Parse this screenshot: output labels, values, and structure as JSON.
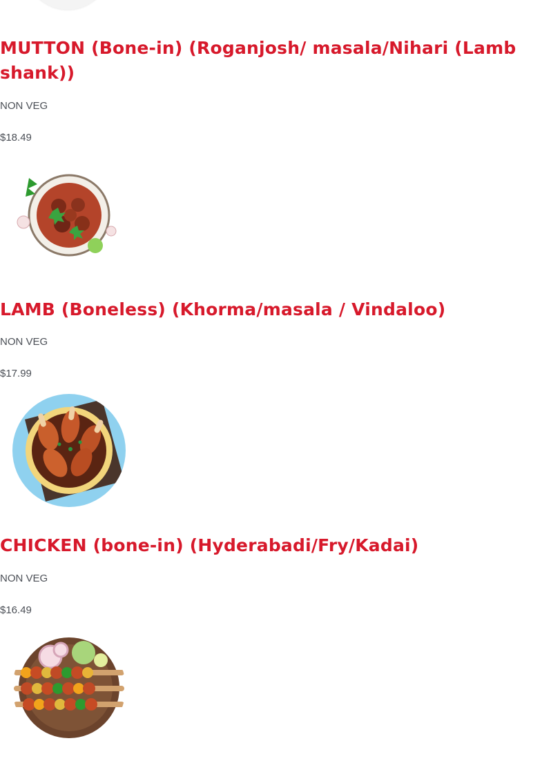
{
  "menu": {
    "items": [
      {
        "name": "MUTTON (Bone-in) (Roganjosh/ masala/Nihari (Lamb shank))",
        "tag": "NON VEG",
        "price": "$18.49",
        "image": "mutton-curry-bowl"
      },
      {
        "name": "LAMB (Boneless) (Khorma/masala / Vindaloo)",
        "tag": "NON VEG",
        "price": "$17.99",
        "image": "chicken-drumstick-curry"
      },
      {
        "name": "CHICKEN (bone-in) (Hyderabadi/Fry/Kadai)",
        "tag": "NON VEG",
        "price": "$16.49",
        "image": "kebab-skewers-platter"
      }
    ]
  },
  "colors": {
    "title": "#d7192b",
    "text": "#4b4f56",
    "background": "#ffffff"
  }
}
